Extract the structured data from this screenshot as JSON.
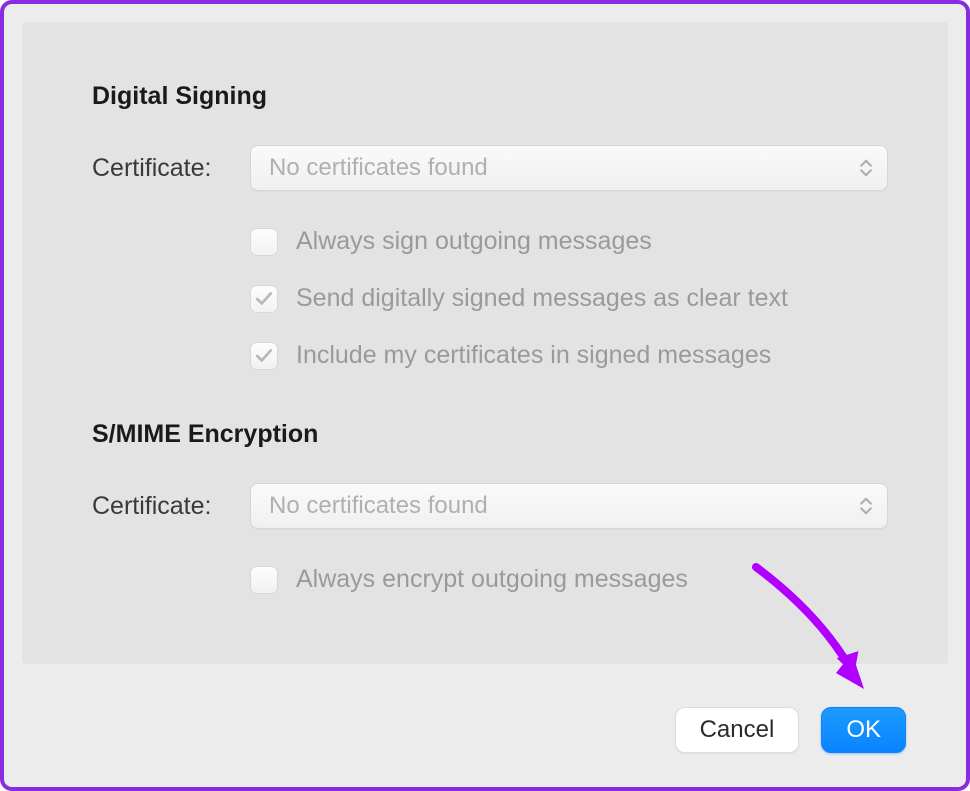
{
  "digital_signing": {
    "title": "Digital Signing",
    "certificate_label": "Certificate:",
    "certificate_value": "No certificates found",
    "options": [
      {
        "label": "Always sign outgoing messages",
        "checked": false
      },
      {
        "label": "Send digitally signed messages as clear text",
        "checked": true
      },
      {
        "label": "Include my certificates in signed messages",
        "checked": true
      }
    ]
  },
  "smime_encryption": {
    "title": "S/MIME Encryption",
    "certificate_label": "Certificate:",
    "certificate_value": "No certificates found",
    "options": [
      {
        "label": "Always encrypt outgoing messages",
        "checked": false
      }
    ]
  },
  "buttons": {
    "cancel": "Cancel",
    "ok": "OK"
  },
  "colors": {
    "accent": "#0a84ff",
    "annotation": "#b100ff"
  }
}
